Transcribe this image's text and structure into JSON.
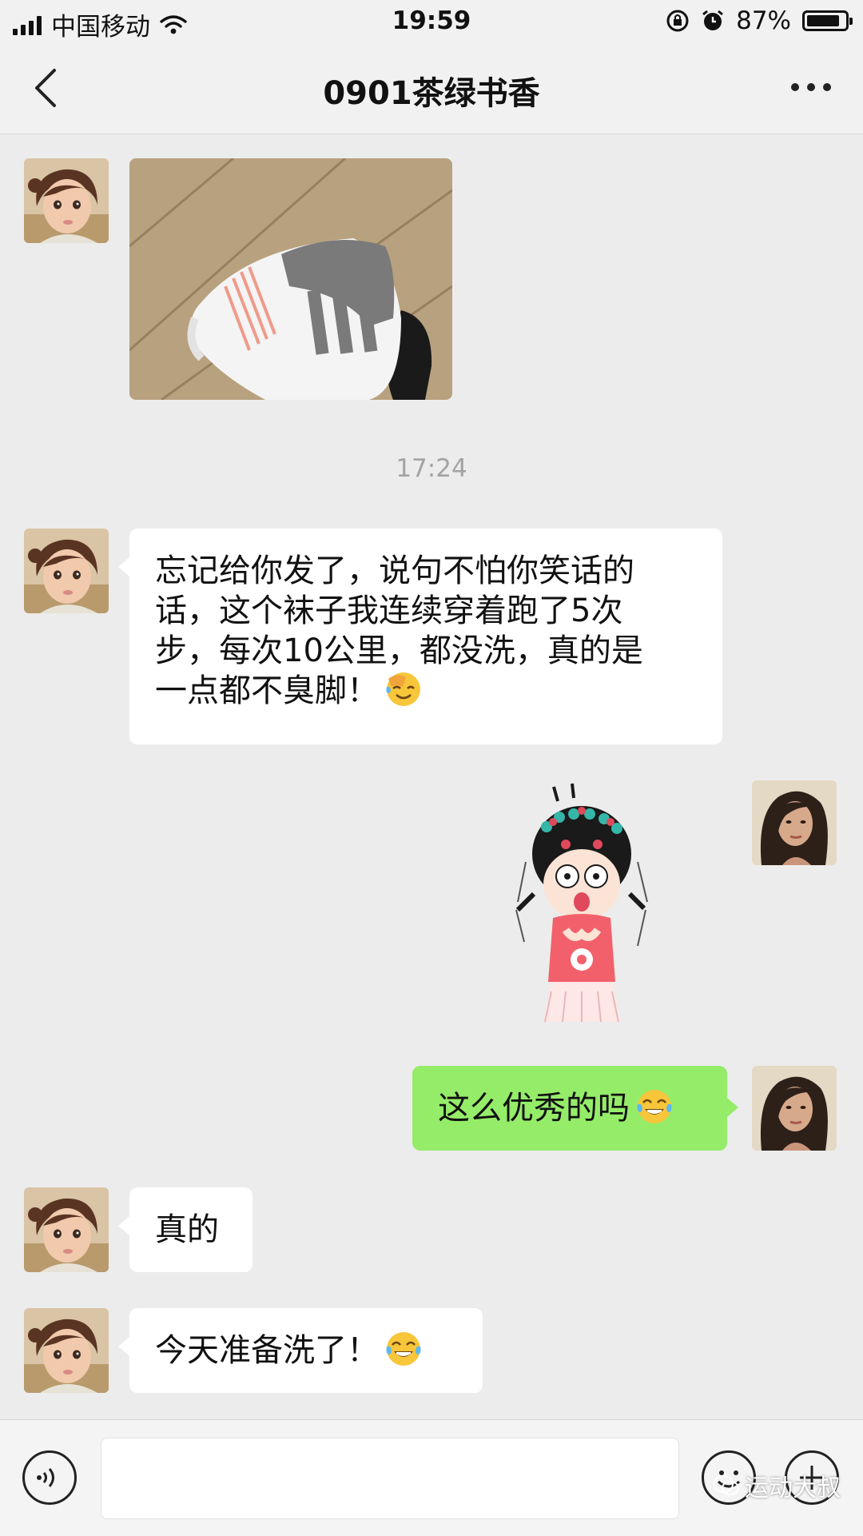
{
  "status_bar": {
    "carrier": "中国移动",
    "time": "19:59",
    "battery_percent": "87%",
    "battery_level": 0.87,
    "icons": [
      "signal-icon",
      "wifi-icon",
      "rotation-lock-icon",
      "alarm-icon",
      "battery-icon"
    ]
  },
  "header": {
    "title": "0901茶绿书香",
    "back_icon": "chevron-left-icon",
    "more_icon": "more-dots-icon"
  },
  "messages": [
    {
      "side": "left",
      "type": "image",
      "content": "photo of white sock with gray stripes"
    },
    {
      "type": "timestamp",
      "text": "17:24"
    },
    {
      "side": "left",
      "type": "text",
      "lines": [
        "忘记给你发了，说句不怕你笑话的",
        "话，这个袜子我连续穿着跑了5次",
        "步，每次10公里，都没洗，真的是",
        "一点都不臭脚！"
      ],
      "emoji": "facepalm-emoji"
    },
    {
      "side": "right",
      "type": "sticker",
      "content": "shocked cartoon girl sticker"
    },
    {
      "side": "right",
      "type": "text",
      "text": "这么优秀的吗",
      "emoji": "tears-of-joy-emoji"
    },
    {
      "side": "left",
      "type": "text",
      "text": "真的"
    },
    {
      "side": "left",
      "type": "text",
      "text": "今天准备洗了！",
      "emoji": "tears-of-joy-emoji"
    }
  ],
  "input_bar": {
    "voice_icon": "voice-icon",
    "emoji_icon": "emoji-icon",
    "plus_icon": "plus-icon",
    "watermark": "运动大叔"
  },
  "colors": {
    "background": "#ececec",
    "bubble_left": "#ffffff",
    "bubble_right": "#95ec69",
    "timestamp": "#a3a3a3"
  }
}
